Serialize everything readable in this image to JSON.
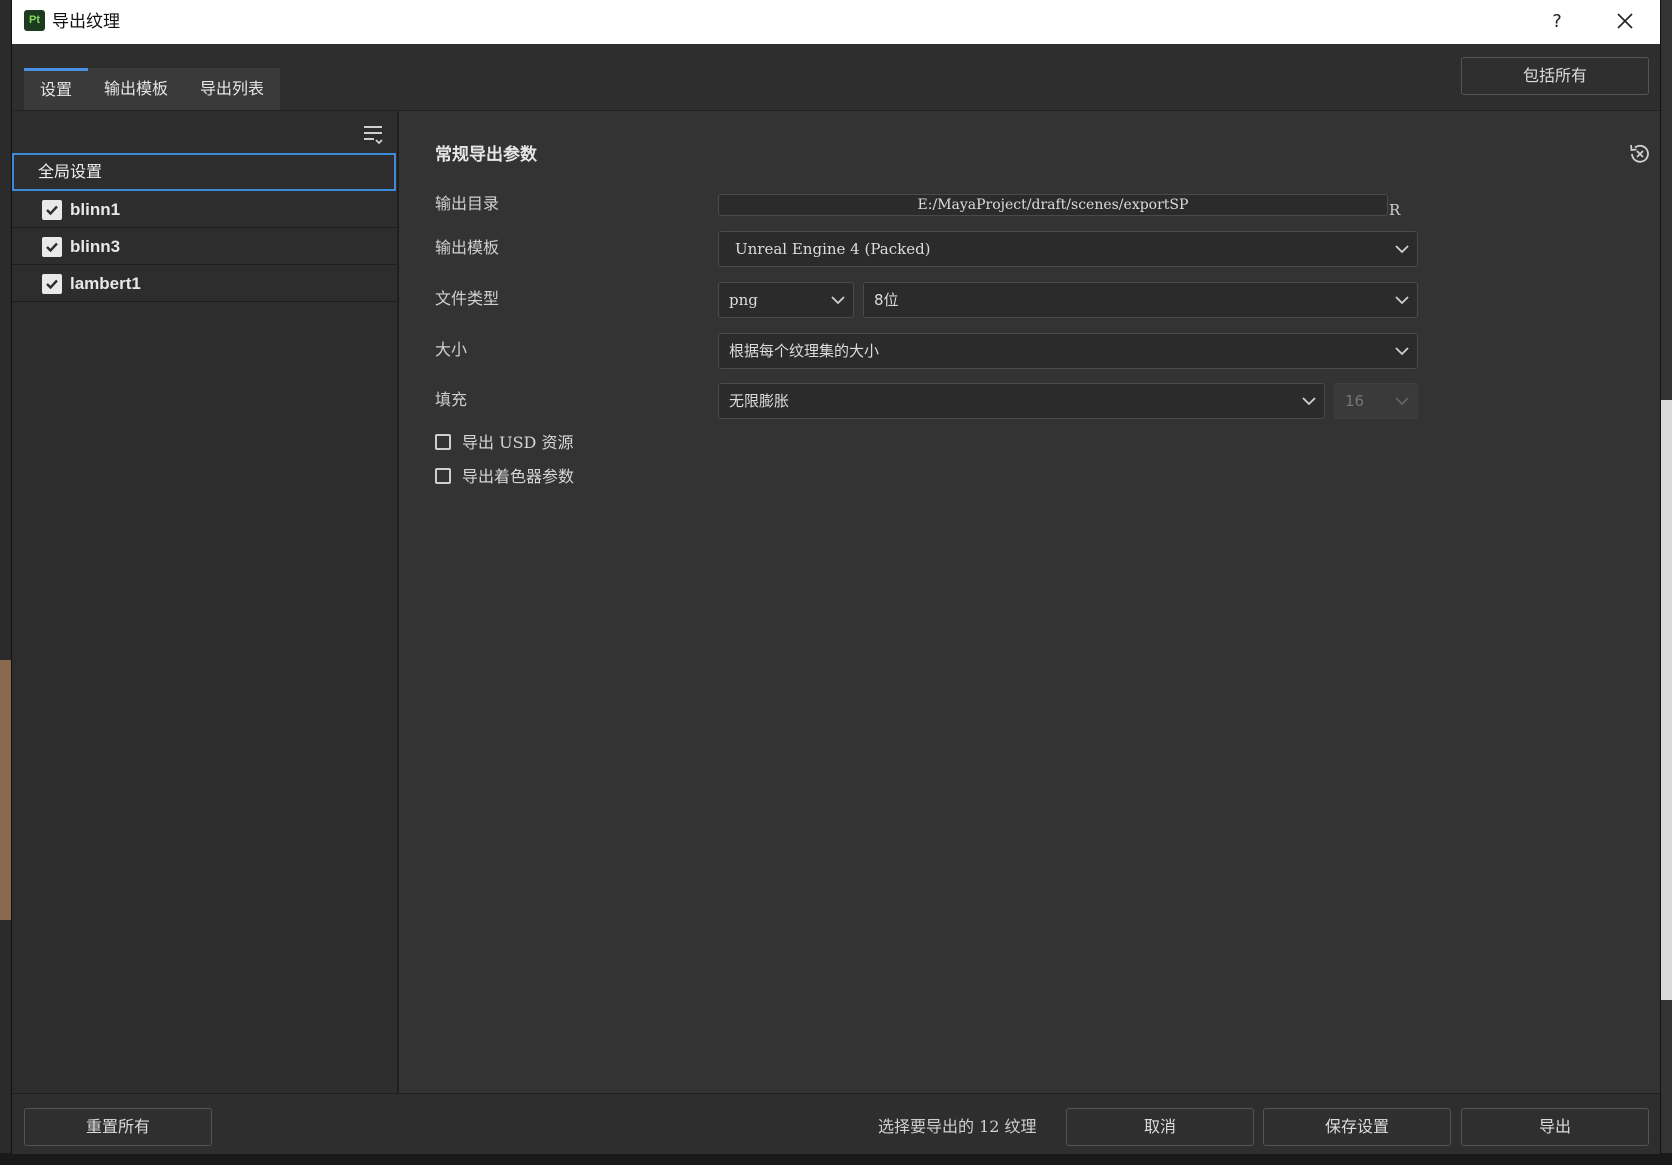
{
  "window": {
    "app_icon": "Pt",
    "title": "导出纹理",
    "help": "?"
  },
  "tabs": [
    {
      "label": "设置",
      "active": true
    },
    {
      "label": "输出模板",
      "active": false
    },
    {
      "label": "导出列表",
      "active": false
    }
  ],
  "include_all_label": "包括所有",
  "left_panel": {
    "global_label": "全局设置",
    "texture_sets": [
      {
        "label": "blinn1",
        "checked": true
      },
      {
        "label": "blinn3",
        "checked": true
      },
      {
        "label": "lambert1",
        "checked": true
      }
    ]
  },
  "settings": {
    "section_title": "常规导出参数",
    "output_dir": {
      "label": "输出目录",
      "value": "E:/MayaProject/draft/scenes/exportSP",
      "suffix": "R"
    },
    "output_template": {
      "label": "输出模板",
      "value": "Unreal Engine 4 (Packed)"
    },
    "file_type": {
      "label": "文件类型",
      "format": "png",
      "bit_depth": "8位"
    },
    "size": {
      "label": "大小",
      "value": "根据每个纹理集的大小"
    },
    "padding": {
      "label": "填充",
      "value": "无限膨胀",
      "distance": "16"
    },
    "export_usd": {
      "label": "导出 USD 资源",
      "checked": false
    },
    "export_shader": {
      "label": "导出着色器参数",
      "checked": false
    }
  },
  "footer": {
    "reset_all": "重置所有",
    "status": "选择要导出的 12 纹理",
    "cancel": "取消",
    "save_settings": "保存设置",
    "export": "导出"
  },
  "colors": {
    "accent": "#4a90e2",
    "panel": "#333333",
    "app_icon_text": "#7fdc5a"
  }
}
